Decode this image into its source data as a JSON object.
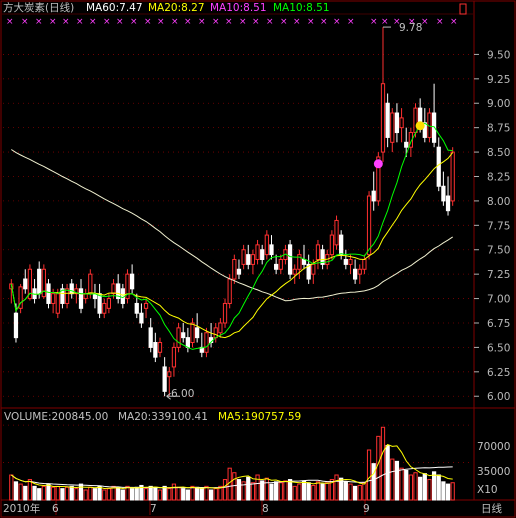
{
  "header": {
    "title": "方大炭素(日线)",
    "ma60_text": "MA60:7.47",
    "ma20_text": "MA20:8.27",
    "ma10a_text": "MA10:8.51",
    "ma10b_text": "MA10:8.51"
  },
  "volume_header": {
    "volume_text": "VOLUME:200845.00",
    "ma20_text": "MA20:339100.41",
    "ma5_text": "MA5:190757.59"
  },
  "annotations": {
    "high_label": "9.78",
    "low_label": "6.00"
  },
  "date_axis": {
    "labels": [
      "2010年",
      "6",
      "7",
      "8",
      "9"
    ],
    "period_label": "日线"
  },
  "volume_axis": {
    "ticks": [
      "70000",
      "35000"
    ],
    "unit": "X10"
  },
  "colors": {
    "up": "#ff3030",
    "down": "#ffffff",
    "ma60": "#ffff00",
    "ma20": "#ffff00",
    "ma10_label": "#ff40ff",
    "ma10_line": "#00ff00",
    "ma5_vol": "#ffff00",
    "grid": "#800000",
    "text": "#c0c0c0"
  },
  "chart_data": {
    "type": "candlestick",
    "y_ticks": [
      6.0,
      6.25,
      6.5,
      6.75,
      7.0,
      7.25,
      7.5,
      7.75,
      8.0,
      8.25,
      8.5,
      8.75,
      9.0,
      9.25,
      9.5
    ],
    "ylim": [
      5.9,
      9.75
    ],
    "high": 9.78,
    "low": 6.0,
    "candles": [
      [
        7.1,
        7.2,
        6.95,
        7.15
      ],
      [
        6.85,
        6.95,
        6.55,
        6.6
      ],
      [
        6.9,
        7.15,
        6.85,
        7.12
      ],
      [
        7.2,
        7.3,
        7.05,
        7.1
      ],
      [
        7.0,
        7.35,
        6.98,
        7.3
      ],
      [
        7.1,
        7.2,
        6.95,
        7.0
      ],
      [
        7.3,
        7.38,
        7.0,
        7.05
      ],
      [
        7.02,
        7.35,
        7.0,
        7.3
      ],
      [
        7.15,
        7.2,
        6.9,
        6.95
      ],
      [
        6.95,
        7.1,
        6.85,
        7.05
      ],
      [
        6.85,
        7.1,
        6.8,
        7.05
      ],
      [
        7.1,
        7.15,
        6.9,
        6.95
      ],
      [
        6.95,
        7.15,
        6.9,
        7.1
      ],
      [
        7.15,
        7.2,
        7.0,
        7.05
      ],
      [
        7.05,
        7.15,
        6.95,
        7.1
      ],
      [
        7.1,
        7.2,
        6.85,
        6.9
      ],
      [
        7.0,
        7.1,
        6.95,
        7.05
      ],
      [
        7.05,
        7.3,
        7.0,
        7.25
      ],
      [
        7.05,
        7.15,
        6.9,
        7.0
      ],
      [
        7.05,
        7.15,
        6.8,
        6.85
      ],
      [
        6.85,
        7.0,
        6.8,
        6.95
      ],
      [
        6.9,
        7.05,
        6.85,
        7.0
      ],
      [
        7.05,
        7.2,
        7.0,
        7.15
      ],
      [
        7.15,
        7.25,
        6.95,
        7.0
      ],
      [
        7.1,
        7.15,
        6.9,
        6.95
      ],
      [
        7.0,
        7.3,
        6.95,
        7.25
      ],
      [
        7.25,
        7.35,
        7.05,
        7.1
      ],
      [
        6.95,
        7.05,
        6.8,
        6.85
      ],
      [
        6.85,
        6.95,
        6.7,
        6.75
      ],
      [
        6.9,
        7.0,
        6.8,
        6.95
      ],
      [
        6.7,
        6.8,
        6.45,
        6.5
      ],
      [
        6.55,
        6.65,
        6.35,
        6.4
      ],
      [
        6.45,
        6.6,
        6.4,
        6.55
      ],
      [
        6.3,
        6.4,
        6.0,
        6.05
      ],
      [
        6.2,
        6.3,
        6.0,
        6.25
      ],
      [
        6.3,
        6.55,
        6.2,
        6.5
      ],
      [
        6.5,
        6.75,
        6.45,
        6.7
      ],
      [
        6.65,
        6.75,
        6.55,
        6.6
      ],
      [
        6.6,
        6.7,
        6.45,
        6.5
      ],
      [
        6.55,
        6.8,
        6.5,
        6.75
      ],
      [
        6.7,
        6.85,
        6.55,
        6.6
      ],
      [
        6.5,
        6.65,
        6.4,
        6.45
      ],
      [
        6.45,
        6.7,
        6.4,
        6.65
      ],
      [
        6.6,
        6.75,
        6.5,
        6.55
      ],
      [
        6.6,
        6.75,
        6.55,
        6.7
      ],
      [
        6.65,
        6.8,
        6.6,
        6.75
      ],
      [
        6.75,
        7.0,
        6.7,
        6.95
      ],
      [
        6.95,
        7.25,
        6.9,
        7.2
      ],
      [
        7.2,
        7.45,
        7.15,
        7.4
      ],
      [
        7.3,
        7.4,
        7.2,
        7.25
      ],
      [
        7.35,
        7.55,
        7.3,
        7.5
      ],
      [
        7.45,
        7.55,
        7.3,
        7.35
      ],
      [
        7.35,
        7.5,
        7.25,
        7.45
      ],
      [
        7.4,
        7.6,
        7.35,
        7.55
      ],
      [
        7.5,
        7.55,
        7.35,
        7.4
      ],
      [
        7.45,
        7.7,
        7.4,
        7.65
      ],
      [
        7.55,
        7.65,
        7.4,
        7.45
      ],
      [
        7.35,
        7.45,
        7.25,
        7.3
      ],
      [
        7.3,
        7.45,
        7.25,
        7.4
      ],
      [
        7.4,
        7.55,
        7.35,
        7.5
      ],
      [
        7.55,
        7.6,
        7.2,
        7.25
      ],
      [
        7.25,
        7.35,
        7.15,
        7.3
      ],
      [
        7.3,
        7.5,
        7.2,
        7.45
      ],
      [
        7.4,
        7.55,
        7.3,
        7.35
      ],
      [
        7.35,
        7.45,
        7.15,
        7.2
      ],
      [
        7.25,
        7.4,
        7.15,
        7.35
      ],
      [
        7.4,
        7.6,
        7.3,
        7.55
      ],
      [
        7.5,
        7.55,
        7.3,
        7.35
      ],
      [
        7.35,
        7.5,
        7.3,
        7.45
      ],
      [
        7.45,
        7.7,
        7.4,
        7.65
      ],
      [
        7.55,
        7.85,
        7.5,
        7.8
      ],
      [
        7.65,
        7.7,
        7.4,
        7.45
      ],
      [
        7.4,
        7.5,
        7.3,
        7.35
      ],
      [
        7.35,
        7.45,
        7.25,
        7.4
      ],
      [
        7.3,
        7.4,
        7.15,
        7.2
      ],
      [
        7.25,
        7.35,
        7.15,
        7.3
      ],
      [
        7.3,
        7.45,
        7.25,
        7.4
      ],
      [
        7.45,
        8.1,
        7.4,
        8.05
      ],
      [
        8.1,
        8.3,
        7.9,
        8.0
      ],
      [
        8.0,
        8.5,
        7.95,
        8.45
      ],
      [
        8.5,
        9.78,
        8.4,
        9.2
      ],
      [
        9.0,
        9.1,
        8.55,
        8.65
      ],
      [
        8.6,
        8.95,
        8.5,
        8.9
      ],
      [
        8.9,
        9.0,
        8.6,
        8.7
      ],
      [
        8.75,
        8.95,
        8.6,
        8.85
      ],
      [
        8.6,
        8.75,
        8.45,
        8.55
      ],
      [
        8.55,
        8.75,
        8.45,
        8.7
      ],
      [
        8.7,
        9.0,
        8.65,
        8.95
      ],
      [
        8.95,
        9.05,
        8.7,
        8.8
      ],
      [
        8.8,
        8.95,
        8.6,
        8.65
      ],
      [
        8.65,
        8.95,
        8.6,
        8.9
      ],
      [
        8.9,
        9.2,
        8.55,
        8.6
      ],
      [
        8.55,
        8.65,
        8.1,
        8.15
      ],
      [
        8.15,
        8.3,
        7.95,
        8.0
      ],
      [
        8.05,
        8.25,
        7.85,
        7.9
      ],
      [
        8.0,
        8.55,
        7.95,
        8.5
      ]
    ],
    "volume": [
      55,
      40,
      35,
      30,
      45,
      30,
      25,
      30,
      35,
      28,
      30,
      25,
      28,
      30,
      25,
      35,
      22,
      28,
      25,
      30,
      22,
      25,
      30,
      28,
      22,
      30,
      25,
      28,
      32,
      25,
      30,
      28,
      22,
      30,
      25,
      35,
      28,
      25,
      22,
      30,
      28,
      25,
      30,
      22,
      25,
      30,
      45,
      70,
      60,
      45,
      40,
      50,
      38,
      55,
      42,
      48,
      35,
      40,
      38,
      42,
      45,
      30,
      35,
      42,
      38,
      32,
      40,
      35,
      38,
      45,
      55,
      48,
      40,
      35,
      30,
      32,
      38,
      110,
      80,
      140,
      160,
      120,
      90,
      85,
      70,
      65,
      55,
      60,
      50,
      58,
      45,
      62,
      55,
      40,
      35,
      38
    ],
    "volume_ylim": [
      0,
      165
    ],
    "volume_ticks": [
      35000,
      70000
    ]
  }
}
